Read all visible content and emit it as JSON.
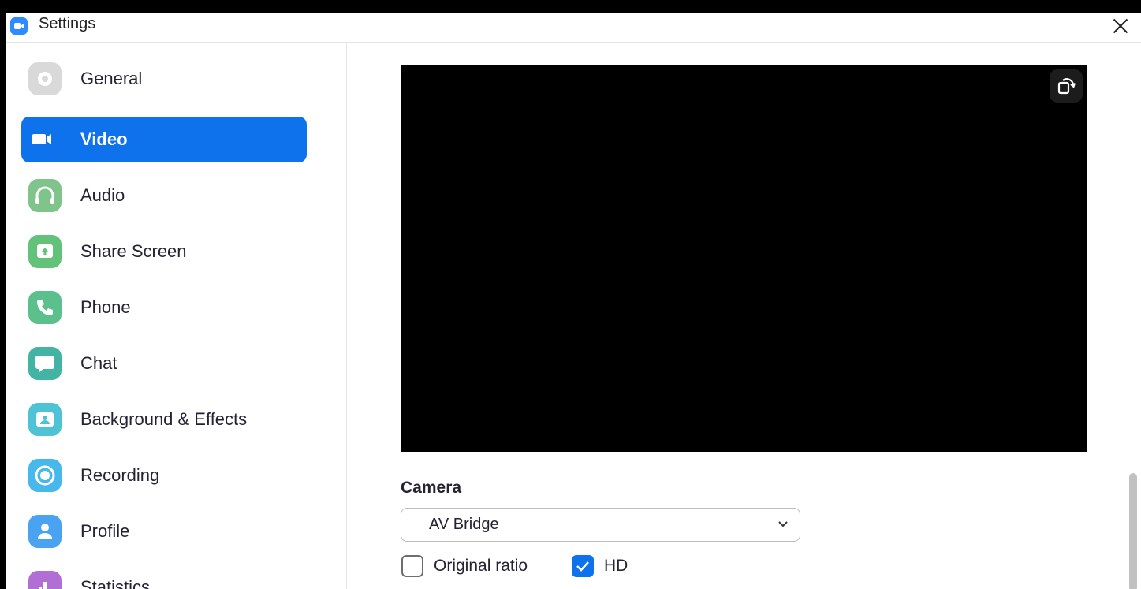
{
  "window": {
    "title": "Settings"
  },
  "sidebar": {
    "items": [
      {
        "label": "General",
        "icon": "gear-icon",
        "color": "#d8d8d8",
        "active": false
      },
      {
        "label": "Video",
        "icon": "video-camera-icon",
        "color": "#ffffff",
        "active": true
      },
      {
        "label": "Audio",
        "icon": "headphones-icon",
        "color": "#7fc48a",
        "active": false
      },
      {
        "label": "Share Screen",
        "icon": "share-screen-icon",
        "color": "#63c27a",
        "active": false
      },
      {
        "label": "Phone",
        "icon": "phone-icon",
        "color": "#5bc08b",
        "active": false
      },
      {
        "label": "Chat",
        "icon": "chat-icon",
        "color": "#43b3a4",
        "active": false
      },
      {
        "label": "Background & Effects",
        "icon": "background-effects-icon",
        "color": "#4fc3d6",
        "active": false
      },
      {
        "label": "Recording",
        "icon": "recording-icon",
        "color": "#47b8ec",
        "active": false
      },
      {
        "label": "Profile",
        "icon": "profile-icon",
        "color": "#4aa3f0",
        "active": false
      },
      {
        "label": "Statistics",
        "icon": "statistics-icon",
        "color": "#b16fd6",
        "active": false
      }
    ]
  },
  "video": {
    "camera_label": "Camera",
    "camera_value": "AV Bridge",
    "original_ratio_label": "Original ratio",
    "original_ratio_checked": false,
    "hd_label": "HD",
    "hd_checked": true
  },
  "colors": {
    "accent": "#0e72ed",
    "brand": "#2d8cff"
  }
}
